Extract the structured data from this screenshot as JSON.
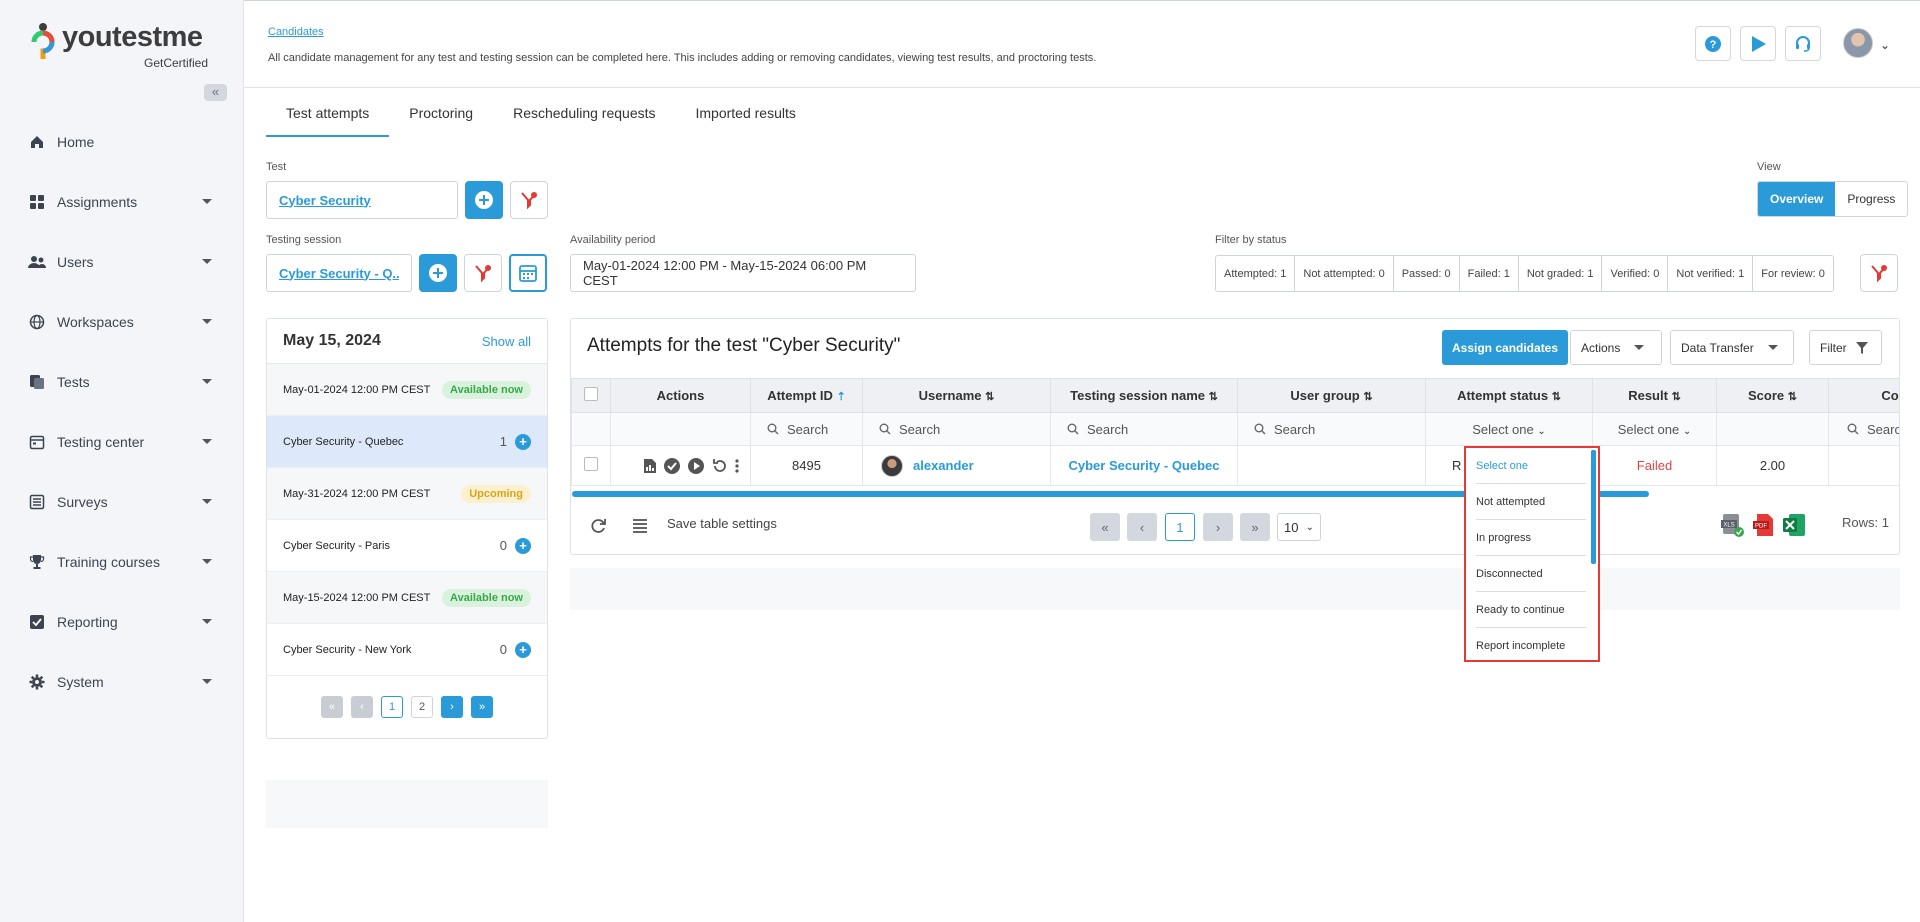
{
  "brand": {
    "name": "youtestme",
    "sub": "GetCertified"
  },
  "nav": [
    {
      "label": "Home",
      "icon": "home-icon",
      "has_caret": false
    },
    {
      "label": "Assignments",
      "icon": "assignments-icon",
      "has_caret": true
    },
    {
      "label": "Users",
      "icon": "users-icon",
      "has_caret": true
    },
    {
      "label": "Workspaces",
      "icon": "globe-icon",
      "has_caret": true
    },
    {
      "label": "Tests",
      "icon": "tests-icon",
      "has_caret": true
    },
    {
      "label": "Testing center",
      "icon": "calendar-icon",
      "has_caret": true
    },
    {
      "label": "Surveys",
      "icon": "list-icon",
      "has_caret": true
    },
    {
      "label": "Training courses",
      "icon": "trophy-icon",
      "has_caret": true
    },
    {
      "label": "Reporting",
      "icon": "check-icon",
      "has_caret": true
    },
    {
      "label": "System",
      "icon": "gear-icon",
      "has_caret": true
    }
  ],
  "header": {
    "breadcrumb": "Candidates",
    "description": "All candidate management for any test and testing session can be completed here. This includes adding or removing candidates, viewing test results, and proctoring tests."
  },
  "tabs": [
    "Test attempts",
    "Proctoring",
    "Rescheduling requests",
    "Imported results"
  ],
  "form": {
    "test_label": "Test",
    "test_value": "Cyber Security",
    "session_label": "Testing session",
    "session_value": "Cyber Security - Q...",
    "availability_label": "Availability period",
    "availability_value": "May-01-2024 12:00 PM - May-15-2024 06:00 PM CEST",
    "view_label": "View",
    "view_options": [
      "Overview",
      "Progress"
    ],
    "filter_status_label": "Filter by status",
    "status_filters": [
      "Attempted: 1",
      "Not attempted: 0",
      "Passed: 0",
      "Failed: 1",
      "Not graded: 1",
      "Verified: 0",
      "Not verified: 1",
      "For review: 0"
    ]
  },
  "sessions": {
    "date": "May 15, 2024",
    "show_all": "Show all",
    "rows": [
      {
        "text": "May-01-2024 12:00 PM CEST",
        "badge": "Available now"
      },
      {
        "text": "Cyber Security - Quebec",
        "count": "1"
      },
      {
        "text": "May-31-2024 12:00 PM CEST",
        "badge": "Upcoming"
      },
      {
        "text": "Cyber Security - Paris",
        "count": "0"
      },
      {
        "text": "May-15-2024 12:00 PM CEST",
        "badge": "Available now"
      },
      {
        "text": "Cyber Security - New York",
        "count": "0"
      }
    ],
    "pages": [
      "1",
      "2"
    ]
  },
  "attempts": {
    "title": "Attempts for the test \"Cyber Security\"",
    "assign_label": "Assign candidates",
    "actions_label": "Actions",
    "data_transfer_label": "Data Transfer",
    "filter_label": "Filter",
    "columns": [
      "Actions",
      "Attempt ID",
      "Username",
      "Testing session name",
      "User group",
      "Attempt status",
      "Result",
      "Score",
      "Co"
    ],
    "search_placeholder": "Search",
    "select_one": "Select one",
    "row": {
      "attempt_id": "8495",
      "username": "alexander",
      "session": "Cyber Security - Quebec",
      "user_group": "",
      "status": "R",
      "result": "Failed",
      "score": "2.00"
    },
    "save_settings": "Save table settings",
    "page": "1",
    "page_size": "10",
    "rows_label": "Rows: 1"
  },
  "status_dropdown": [
    "Select one",
    "Not attempted",
    "In progress",
    "Disconnected",
    "Ready to continue",
    "Report incomplete"
  ],
  "colors": {
    "accent": "#2a9bd8",
    "danger": "#e53935",
    "success": "#38a84a"
  }
}
